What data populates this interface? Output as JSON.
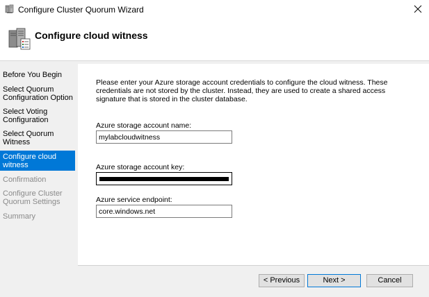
{
  "window": {
    "title": "Configure Cluster Quorum Wizard"
  },
  "header": {
    "title": "Configure cloud witness"
  },
  "sidebar": {
    "steps": [
      {
        "label": "Before You Begin",
        "state": "normal"
      },
      {
        "label": "Select Quorum Configuration Option",
        "state": "normal"
      },
      {
        "label": "Select Voting Configuration",
        "state": "normal"
      },
      {
        "label": "Select Quorum Witness",
        "state": "normal"
      },
      {
        "label": "Configure cloud witness",
        "state": "active"
      },
      {
        "label": "Confirmation",
        "state": "disabled"
      },
      {
        "label": "Configure Cluster Quorum Settings",
        "state": "disabled"
      },
      {
        "label": "Summary",
        "state": "disabled"
      }
    ]
  },
  "main": {
    "intro": "Please enter your Azure storage account credentials to configure the cloud witness. These credentials are not stored by the cluster. Instead, they are used to create a shared access signature that is stored in the cluster database.",
    "account_name_label": "Azure storage account name:",
    "account_name_value": "mylabcloudwitness",
    "account_key_label": "Azure storage account key:",
    "endpoint_label": "Azure service endpoint:",
    "endpoint_value": "core.windows.net"
  },
  "buttons": {
    "previous": "< Previous",
    "next": "Next >",
    "cancel": "Cancel"
  },
  "colors": {
    "accent": "#0078d7",
    "sidebar_bg": "#f0f0f0"
  },
  "icons": {
    "title": "cluster-server-icon",
    "header": "cluster-server-icon",
    "close": "close-icon"
  }
}
